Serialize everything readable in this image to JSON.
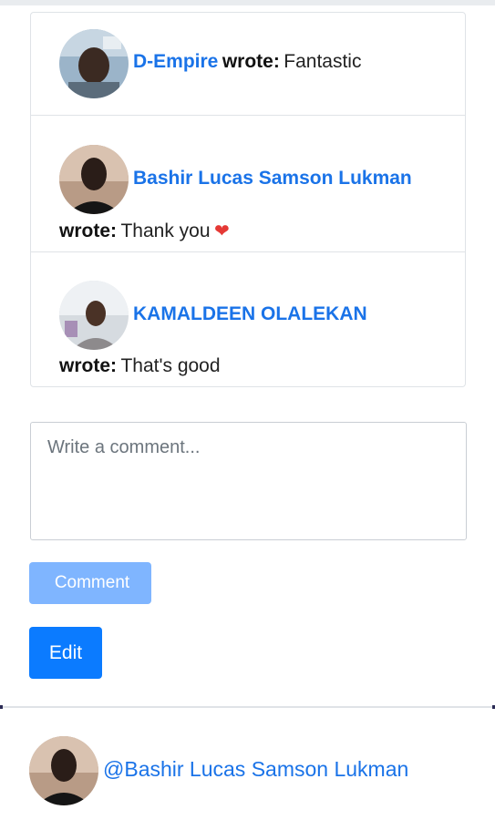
{
  "comments": [
    {
      "author": "D-Empire",
      "wrote_label": "wrote:",
      "text": "Fantastic"
    },
    {
      "author": "Bashir Lucas Samson Lukman",
      "wrote_label": "wrote:",
      "text": "Thank you",
      "emoji": "❤"
    },
    {
      "author": "KAMALDEEN OLALEKAN",
      "wrote_label": "wrote:",
      "text": "That's good"
    }
  ],
  "comment_box": {
    "placeholder": "Write a comment..."
  },
  "buttons": {
    "comment_icon": "",
    "comment_label": "Comment",
    "edit_label": "Edit"
  },
  "next_post": {
    "mention": "@Bashir Lucas Samson Lukman"
  },
  "colors": {
    "link": "#1a73e8",
    "primary": "#0b7bff",
    "primary_disabled": "#7fb5ff",
    "border": "#dfe3e7"
  }
}
